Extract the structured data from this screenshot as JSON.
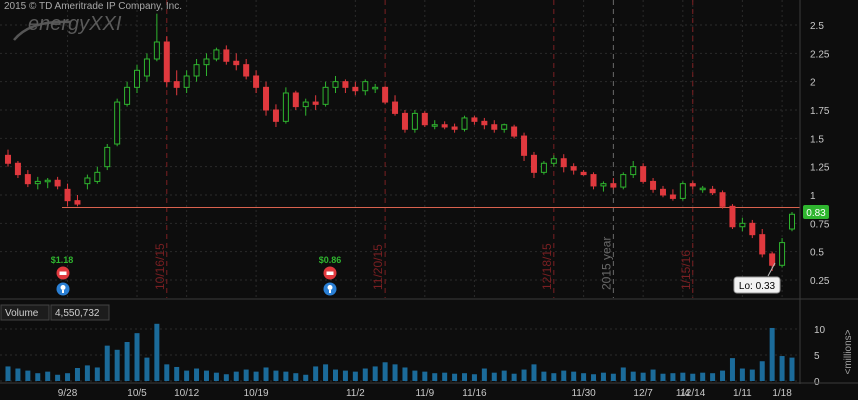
{
  "copyright": "2015 © TD Ameritrade IP Company, Inc.",
  "symbol_watermark": "energyXXI",
  "colors": {
    "background": "#0d0d0d",
    "grid": "#2a2a2a",
    "up": "#2fb52f",
    "down": "#e0393e",
    "ref_line": "#d9624e",
    "vertical_marker": "#7a1f22",
    "year_marker": "#6a6a6a",
    "volume_bar": "#1b6b9a",
    "price_label_bg": "#2fb52f"
  },
  "price_axis": {
    "ticks": [
      "2.5",
      "2.25",
      "2",
      "1.75",
      "1.5",
      "1.25",
      "1",
      "0.75",
      "0.5",
      "0.25"
    ]
  },
  "volume_axis": {
    "ticks": [
      "10",
      "5",
      "0"
    ],
    "unit_label": "<millions>"
  },
  "x_axis": {
    "labels": [
      "9/28",
      "10/5",
      "10/12",
      "10/19",
      "11/2",
      "11/9",
      "11/16",
      "11/30",
      "12/7",
      "12/14",
      "1/4",
      "1/11",
      "1/18"
    ]
  },
  "events": [
    {
      "price": "$1.18"
    },
    {
      "price": "$0.86"
    }
  ],
  "markers": [
    "10/16/15",
    "11/20/15",
    "12/18/15",
    "2015 year",
    "1/15/16"
  ],
  "last_price": "0.83",
  "low_label": "Lo: 0.33",
  "volume_panel": {
    "title": "Volume",
    "value": "4,550,732"
  },
  "chart_data": {
    "type": "candlestick",
    "reference_line": 0.89,
    "ylim": [
      0.1,
      2.7
    ],
    "candles": [
      [
        1.35,
        1.4,
        1.25,
        1.28
      ],
      [
        1.28,
        1.3,
        1.15,
        1.18
      ],
      [
        1.18,
        1.22,
        1.07,
        1.1
      ],
      [
        1.1,
        1.16,
        1.05,
        1.12
      ],
      [
        1.12,
        1.15,
        1.06,
        1.13
      ],
      [
        1.13,
        1.16,
        1.05,
        1.08
      ],
      [
        1.05,
        1.1,
        0.9,
        0.95
      ],
      [
        0.95,
        1.0,
        0.9,
        0.92
      ],
      [
        1.1,
        1.18,
        1.05,
        1.15
      ],
      [
        1.12,
        1.25,
        1.1,
        1.2
      ],
      [
        1.25,
        1.45,
        1.22,
        1.42
      ],
      [
        1.45,
        1.85,
        1.43,
        1.82
      ],
      [
        1.8,
        2.0,
        1.78,
        1.95
      ],
      [
        1.95,
        2.15,
        1.9,
        2.1
      ],
      [
        2.05,
        2.25,
        2.0,
        2.2
      ],
      [
        2.2,
        2.6,
        2.18,
        2.35
      ],
      [
        2.35,
        2.4,
        1.95,
        2.0
      ],
      [
        2.0,
        2.1,
        1.88,
        1.95
      ],
      [
        1.95,
        2.1,
        1.9,
        2.05
      ],
      [
        2.05,
        2.2,
        2.0,
        2.15
      ],
      [
        2.15,
        2.25,
        2.05,
        2.2
      ],
      [
        2.2,
        2.3,
        2.18,
        2.28
      ],
      [
        2.28,
        2.32,
        2.15,
        2.18
      ],
      [
        2.18,
        2.25,
        2.1,
        2.15
      ],
      [
        2.15,
        2.2,
        2.02,
        2.05
      ],
      [
        2.05,
        2.1,
        1.9,
        1.95
      ],
      [
        1.95,
        2.0,
        1.7,
        1.75
      ],
      [
        1.75,
        1.8,
        1.6,
        1.65
      ],
      [
        1.65,
        1.95,
        1.63,
        1.9
      ],
      [
        1.9,
        1.92,
        1.75,
        1.78
      ],
      [
        1.78,
        1.85,
        1.7,
        1.82
      ],
      [
        1.82,
        1.88,
        1.75,
        1.8
      ],
      [
        1.8,
        2.0,
        1.78,
        1.95
      ],
      [
        1.95,
        2.05,
        1.9,
        2.0
      ],
      [
        2.0,
        2.02,
        1.9,
        1.95
      ],
      [
        1.95,
        2.0,
        1.88,
        1.92
      ],
      [
        1.92,
        2.02,
        1.88,
        2.0
      ],
      [
        1.95,
        1.98,
        1.9,
        1.95
      ],
      [
        1.95,
        1.96,
        1.8,
        1.82
      ],
      [
        1.82,
        1.88,
        1.7,
        1.72
      ],
      [
        1.72,
        1.75,
        1.55,
        1.58
      ],
      [
        1.58,
        1.75,
        1.55,
        1.72
      ],
      [
        1.72,
        1.74,
        1.6,
        1.62
      ],
      [
        1.62,
        1.66,
        1.58,
        1.62
      ],
      [
        1.62,
        1.65,
        1.58,
        1.6
      ],
      [
        1.6,
        1.63,
        1.55,
        1.58
      ],
      [
        1.58,
        1.7,
        1.56,
        1.68
      ],
      [
        1.68,
        1.7,
        1.62,
        1.65
      ],
      [
        1.65,
        1.68,
        1.58,
        1.62
      ],
      [
        1.62,
        1.66,
        1.55,
        1.58
      ],
      [
        1.58,
        1.63,
        1.55,
        1.62
      ],
      [
        1.6,
        1.62,
        1.5,
        1.52
      ],
      [
        1.52,
        1.55,
        1.3,
        1.35
      ],
      [
        1.35,
        1.38,
        1.15,
        1.2
      ],
      [
        1.2,
        1.3,
        1.18,
        1.28
      ],
      [
        1.28,
        1.35,
        1.25,
        1.32
      ],
      [
        1.32,
        1.36,
        1.2,
        1.25
      ],
      [
        1.25,
        1.28,
        1.18,
        1.22
      ],
      [
        1.2,
        1.22,
        1.17,
        1.18
      ],
      [
        1.18,
        1.2,
        1.05,
        1.08
      ],
      [
        1.08,
        1.12,
        1.03,
        1.1
      ],
      [
        1.1,
        1.15,
        1.05,
        1.07
      ],
      [
        1.07,
        1.2,
        1.05,
        1.18
      ],
      [
        1.18,
        1.3,
        1.15,
        1.25
      ],
      [
        1.25,
        1.28,
        1.1,
        1.12
      ],
      [
        1.12,
        1.15,
        1.02,
        1.05
      ],
      [
        1.05,
        1.08,
        0.98,
        1.0
      ],
      [
        1.0,
        1.05,
        0.95,
        0.97
      ],
      [
        0.97,
        1.12,
        0.95,
        1.1
      ],
      [
        1.1,
        1.12,
        1.05,
        1.08
      ],
      [
        1.05,
        1.08,
        1.02,
        1.06
      ],
      [
        1.05,
        1.08,
        1.0,
        1.02
      ],
      [
        1.02,
        1.04,
        0.88,
        0.9
      ],
      [
        0.9,
        0.92,
        0.7,
        0.72
      ],
      [
        0.72,
        0.8,
        0.68,
        0.75
      ],
      [
        0.75,
        0.78,
        0.62,
        0.65
      ],
      [
        0.65,
        0.7,
        0.45,
        0.48
      ],
      [
        0.48,
        0.5,
        0.33,
        0.38
      ],
      [
        0.38,
        0.62,
        0.36,
        0.58
      ],
      [
        0.7,
        0.85,
        0.68,
        0.83
      ]
    ],
    "volume": [
      2.8,
      2.4,
      2.0,
      1.5,
      1.8,
      1.2,
      1.5,
      2.5,
      3.0,
      2.6,
      6.8,
      6.0,
      7.5,
      9.2,
      4.5,
      11.0,
      3.2,
      2.7,
      2.0,
      2.4,
      2.0,
      1.6,
      1.3,
      1.8,
      2.2,
      1.8,
      2.6,
      2.0,
      1.8,
      1.5,
      1.2,
      2.8,
      3.2,
      2.2,
      2.0,
      1.8,
      2.4,
      2.8,
      3.6,
      3.2,
      2.6,
      2.0,
      1.8,
      1.5,
      1.6,
      1.4,
      1.5,
      1.3,
      2.4,
      1.6,
      2.0,
      1.4,
      2.2,
      3.2,
      1.8,
      1.5,
      2.0,
      1.8,
      1.5,
      1.3,
      1.6,
      1.4,
      2.6,
      1.8,
      1.6,
      2.2,
      1.4,
      1.5,
      1.6,
      1.4,
      1.6,
      1.5,
      2.0,
      4.4,
      2.4,
      2.2,
      3.8,
      10.2,
      4.8,
      4.5
    ]
  }
}
